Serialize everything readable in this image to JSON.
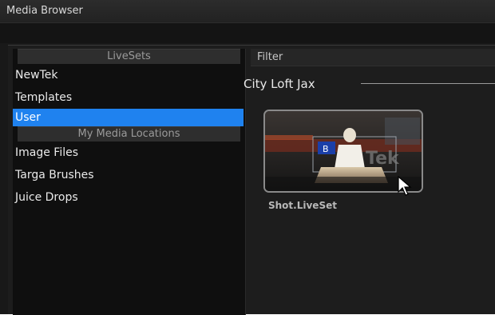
{
  "window": {
    "title": "Media Browser"
  },
  "sidebar": {
    "livesets_header": "LiveSets",
    "livesets_items": [
      {
        "label": "NewTek",
        "selected": false
      },
      {
        "label": "Templates",
        "selected": false
      },
      {
        "label": "User",
        "selected": true
      }
    ],
    "locations_header": "My Media Locations",
    "locations_items": [
      {
        "label": "Image Files"
      },
      {
        "label": "Targa Brushes"
      },
      {
        "label": "Juice Drops"
      }
    ]
  },
  "main": {
    "filter_label": "Filter",
    "group_title": "City Loft Jax",
    "items": [
      {
        "label": "Shot.LiveSet",
        "icon": "liveset-thumbnail",
        "thumb_badge": "B",
        "thumb_logo_text": "Tek"
      }
    ]
  },
  "colors": {
    "selection": "#1f82ef",
    "background": "#191919"
  }
}
